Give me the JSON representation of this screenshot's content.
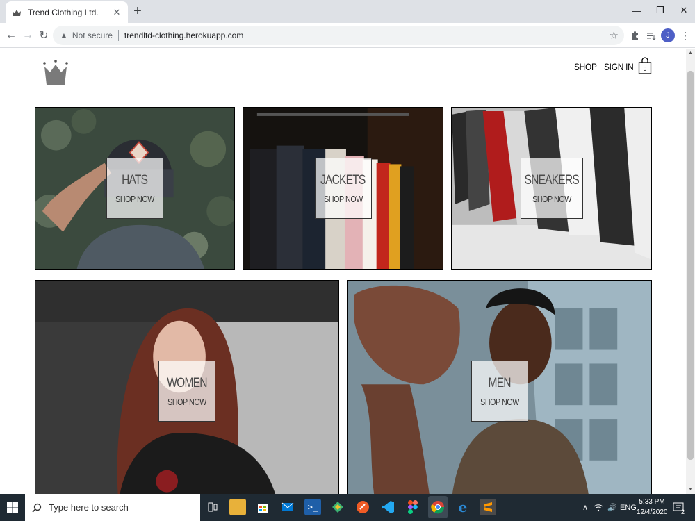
{
  "browser": {
    "tab_title": "Trend Clothing Ltd.",
    "security_label": "Not secure",
    "url": "trendltd-clothing.herokuapp.com",
    "profile_initial": "J"
  },
  "header": {
    "nav": [
      {
        "label": "SHOP"
      },
      {
        "label": "SIGN IN"
      }
    ],
    "cart_count": "0"
  },
  "categories": [
    {
      "title": "HATS",
      "subtitle": "SHOP NOW"
    },
    {
      "title": "JACKETS",
      "subtitle": "SHOP NOW"
    },
    {
      "title": "SNEAKERS",
      "subtitle": "SHOP NOW"
    },
    {
      "title": "WOMEN",
      "subtitle": "SHOP NOW"
    },
    {
      "title": "MEN",
      "subtitle": "SHOP NOW"
    }
  ],
  "taskbar": {
    "search_placeholder": "Type here to search",
    "language": "ENG",
    "time": "5:33 PM",
    "date": "12/4/2020",
    "notification_count": "2"
  },
  "colors": {
    "taskbar_bg": "#1f2a33",
    "tabstrip_bg": "#dee1e6",
    "profile_bg": "#4e5fc6"
  }
}
